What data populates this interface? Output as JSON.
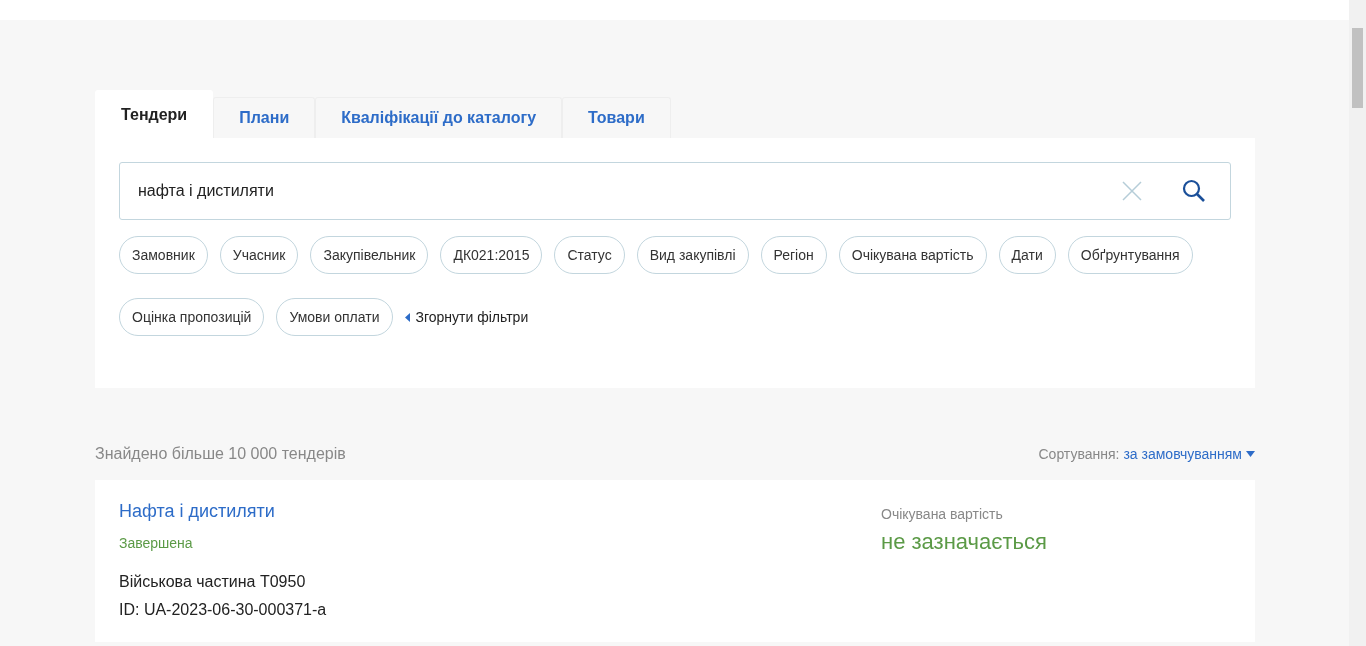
{
  "tabs": [
    {
      "label": "Тендери",
      "selected": true
    },
    {
      "label": "Плани",
      "selected": false
    },
    {
      "label": "Кваліфікації до каталогу",
      "selected": false
    },
    {
      "label": "Товари",
      "selected": false
    }
  ],
  "search": {
    "value": "нафта і дистиляти"
  },
  "filters": [
    {
      "label": "Замовник"
    },
    {
      "label": "Учасник"
    },
    {
      "label": "Закупівельник"
    },
    {
      "label": "ДК021:2015"
    },
    {
      "label": "Статус"
    },
    {
      "label": "Вид закупівлі"
    },
    {
      "label": "Регіон"
    },
    {
      "label": "Очікувана вартість"
    },
    {
      "label": "Дати"
    },
    {
      "label": "Обґрунтування"
    },
    {
      "label": "Оцінка пропозицій"
    },
    {
      "label": "Умови оплати"
    }
  ],
  "collapse_filters": "Згорнути фільтри",
  "results_count": "Знайдено більше 10 000 тендерів",
  "sort": {
    "label": "Сортування:",
    "value": "за замовчуванням"
  },
  "results": [
    {
      "title": "Нафта і дистиляти",
      "status": "Завершена",
      "buyer": "Військова частина Т0950",
      "id": "ID: UA-2023-06-30-000371-a",
      "value_label": "Очікувана вартість",
      "value": "не зазначається"
    }
  ]
}
